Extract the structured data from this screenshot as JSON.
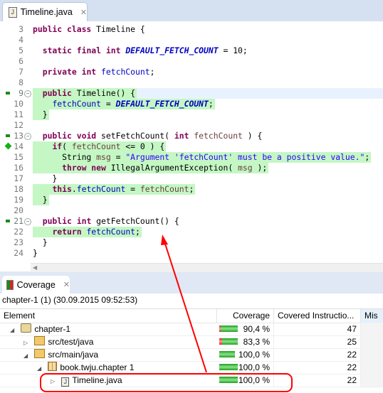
{
  "editor": {
    "tab_title": "Timeline.java",
    "lines": [
      {
        "n": "3",
        "t": [
          [
            "k",
            "public class "
          ],
          [
            "p",
            "Timeline {"
          ]
        ]
      },
      {
        "n": "4",
        "t": []
      },
      {
        "n": "5",
        "t": [
          [
            "p",
            "  "
          ],
          [
            "k",
            "static final int "
          ],
          [
            "c",
            "DEFAULT_FETCH_COUNT"
          ],
          [
            "p",
            " = 10;"
          ]
        ]
      },
      {
        "n": "6",
        "t": []
      },
      {
        "n": "7",
        "t": [
          [
            "p",
            "  "
          ],
          [
            "k",
            "private int "
          ],
          [
            "f",
            "fetchCount"
          ],
          [
            "p",
            ";"
          ]
        ]
      },
      {
        "n": "8",
        "t": []
      },
      {
        "n": "9",
        "t": [
          [
            "p",
            "  "
          ],
          [
            "k",
            "public "
          ],
          [
            "p",
            "Timeline() {"
          ]
        ],
        "hl": true,
        "cur": true,
        "mark": "square",
        "fold": true
      },
      {
        "n": "10",
        "t": [
          [
            "p",
            "    "
          ],
          [
            "f",
            "fetchCount"
          ],
          [
            "p",
            " = "
          ],
          [
            "c",
            "DEFAULT_FETCH_COUNT"
          ],
          [
            "p",
            ";"
          ]
        ],
        "hl": true
      },
      {
        "n": "11",
        "t": [
          [
            "p",
            "  }"
          ]
        ],
        "hl": true
      },
      {
        "n": "12",
        "t": []
      },
      {
        "n": "13",
        "t": [
          [
            "p",
            "  "
          ],
          [
            "k",
            "public void "
          ],
          [
            "p",
            "setFetchCount( "
          ],
          [
            "k",
            "int "
          ],
          [
            "v",
            "fetchCount"
          ],
          [
            "p",
            " ) {"
          ]
        ],
        "mark": "square",
        "fold": true
      },
      {
        "n": "14",
        "t": [
          [
            "p",
            "    "
          ],
          [
            "k",
            "if"
          ],
          [
            "p",
            "( "
          ],
          [
            "v",
            "fetchCount"
          ],
          [
            "p",
            " <= 0 ) {"
          ]
        ],
        "hl": true,
        "mark": "diamond"
      },
      {
        "n": "15",
        "t": [
          [
            "p",
            "      String "
          ],
          [
            "v",
            "msg"
          ],
          [
            "p",
            " = "
          ],
          [
            "s",
            "\"Argument 'fetchCount' must be a positive value.\""
          ],
          [
            "p",
            ";"
          ]
        ],
        "hl": true
      },
      {
        "n": "16",
        "t": [
          [
            "p",
            "      "
          ],
          [
            "k",
            "throw new "
          ],
          [
            "p",
            "IllegalArgumentException( "
          ],
          [
            "v",
            "msg"
          ],
          [
            "p",
            " );"
          ]
        ],
        "hl": true
      },
      {
        "n": "17",
        "t": [
          [
            "p",
            "    }"
          ]
        ]
      },
      {
        "n": "18",
        "t": [
          [
            "p",
            "    "
          ],
          [
            "k",
            "this"
          ],
          [
            "p",
            "."
          ],
          [
            "f",
            "fetchCount"
          ],
          [
            "p",
            " = "
          ],
          [
            "v",
            "fetchCount"
          ],
          [
            "p",
            ";"
          ]
        ],
        "hl": true
      },
      {
        "n": "19",
        "t": [
          [
            "p",
            "  }"
          ]
        ],
        "hl": true
      },
      {
        "n": "20",
        "t": []
      },
      {
        "n": "21",
        "t": [
          [
            "p",
            "  "
          ],
          [
            "k",
            "public int "
          ],
          [
            "p",
            "getFetchCount() {"
          ]
        ],
        "mark": "square",
        "fold": true
      },
      {
        "n": "22",
        "t": [
          [
            "p",
            "    "
          ],
          [
            "k",
            "return "
          ],
          [
            "f",
            "fetchCount"
          ],
          [
            "p",
            ";"
          ]
        ],
        "hl": true
      },
      {
        "n": "23",
        "t": [
          [
            "p",
            "  }"
          ]
        ]
      },
      {
        "n": "24",
        "t": [
          [
            "p",
            "}"
          ]
        ]
      }
    ]
  },
  "coverage": {
    "tab_title": "Coverage",
    "session": "chapter-1 (1) (30.09.2015 09:52:53)",
    "columns": [
      "Element",
      "Coverage",
      "Covered Instructio...",
      "Mis"
    ],
    "rows": [
      {
        "name": "chapter-1",
        "indent": 0,
        "expander": "expanded",
        "icon": "project-folder-icon",
        "coverage": "90,4 %",
        "ratio": 0.904,
        "covered": "47"
      },
      {
        "name": "src/test/java",
        "indent": 1,
        "expander": "collapsed",
        "icon": "source-folder-icon",
        "coverage": "83,3 %",
        "ratio": 0.833,
        "covered": "25"
      },
      {
        "name": "src/main/java",
        "indent": 1,
        "expander": "expanded",
        "icon": "source-folder-icon",
        "coverage": "100,0 %",
        "ratio": 1.0,
        "covered": "22"
      },
      {
        "name": "book.twju.chapter 1",
        "indent": 2,
        "expander": "expanded",
        "icon": "package-icon",
        "coverage": "100,0 %",
        "ratio": 1.0,
        "covered": "22"
      },
      {
        "name": "Timeline.java",
        "indent": 3,
        "expander": "collapsed",
        "icon": "java-file-icon",
        "coverage": "100,0 %",
        "ratio": 1.0,
        "covered": "22",
        "highlighted": true
      }
    ]
  },
  "colors": {
    "covered": "#c4f7c4",
    "annotation": "#ff0000",
    "bar_green": "#1fa01f",
    "bar_red": "#e02020"
  }
}
